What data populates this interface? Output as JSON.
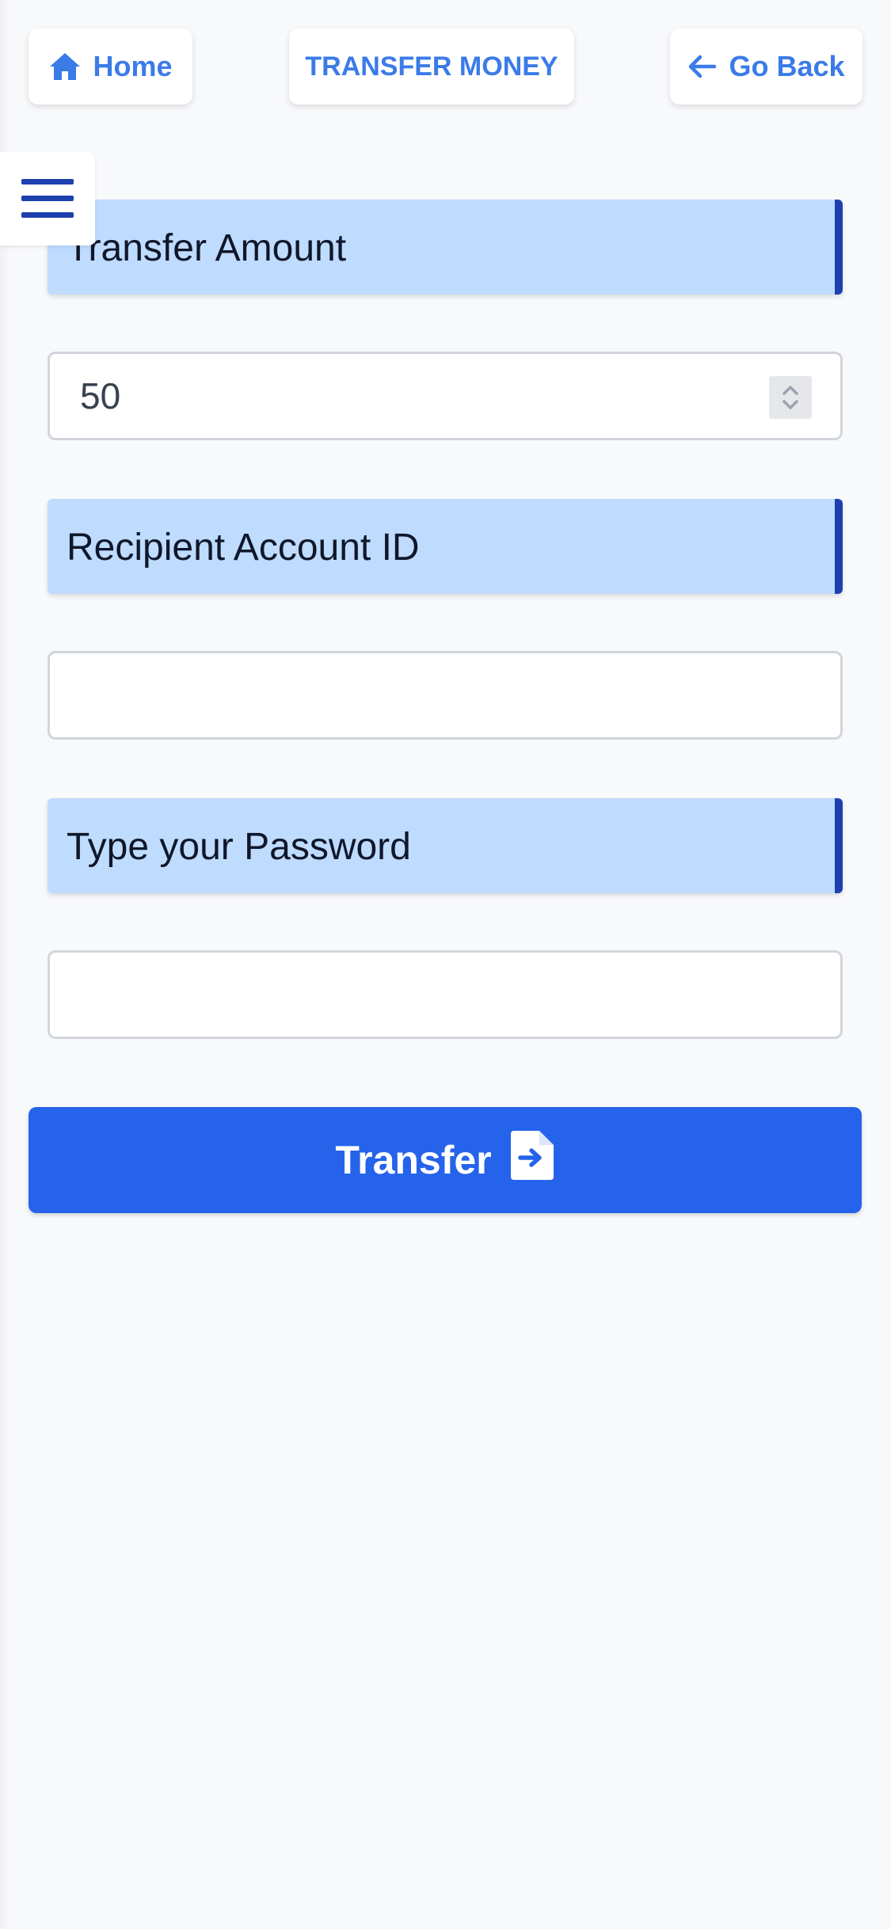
{
  "header": {
    "home_label": "Home",
    "title": "TRANSFER MONEY",
    "back_label": "Go Back"
  },
  "form": {
    "amount_label": "Transfer Amount",
    "amount_value": "50",
    "recipient_label": "Recipient Account ID",
    "recipient_value": "",
    "password_label": "Type your Password",
    "password_value": "",
    "submit_label": "Transfer"
  },
  "icons": {
    "home": "home-icon",
    "back": "arrow-left-icon",
    "menu": "hamburger-menu-icon",
    "spinner": "chevron-up-down-icon",
    "submit": "file-arrow-right-icon"
  },
  "colors": {
    "accent": "#3b7be8",
    "primary_button": "#2563eb",
    "section_bg": "#bfdbfe",
    "section_border": "#1e40af",
    "page_bg": "#f8f9fb"
  }
}
